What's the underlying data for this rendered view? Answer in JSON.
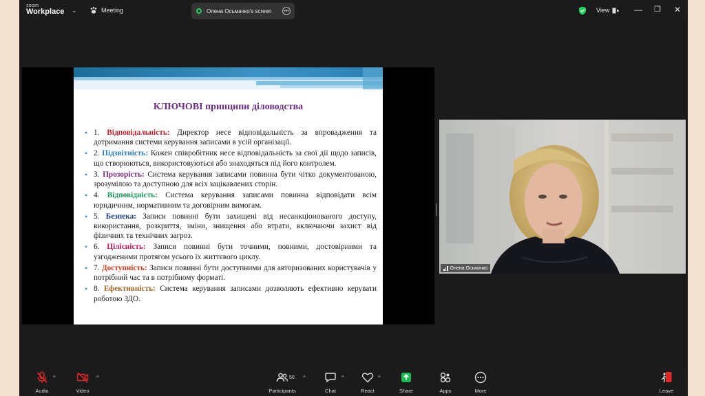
{
  "app": {
    "logo_small": "zoom",
    "logo_big": "Workplace",
    "meeting_label": "Meeting"
  },
  "screen_share": {
    "label": "Олена Осьмачко's screen",
    "indicator_letter": "O"
  },
  "titlebar": {
    "view_label": "View",
    "minimize": "—",
    "restore": "❐",
    "close": "✕"
  },
  "slide": {
    "title": "КЛЮЧОВІ принципи діловодства",
    "items": [
      {
        "num": "1.",
        "kw": "Відповідальність:",
        "color": "#c0202a",
        "text": " Директор несе відповідальність за впровадження та дотримання системи керування записами в усій організації."
      },
      {
        "num": "2.",
        "kw": "Підзвітність:",
        "color": "#2d7bc0",
        "text": " Кожен співробітник несе відповідальність за свої дії щодо записів, що створюються, використовуються або знаходяться під його контролем."
      },
      {
        "num": "3.",
        "kw": "Прозорість:",
        "color": "#7a2a7a",
        "text": " Система керування записами повинна бути чітко документованою, зрозумілою та доступною для всіх зацікавлених сторін."
      },
      {
        "num": "4.",
        "kw": "Відповідність:",
        "color": "#1e9a5a",
        "text": " Система керування записами повинна відповідати всім юридичним, нормативним та договірним вимогам."
      },
      {
        "num": "5.",
        "kw": "Безпека:",
        "color": "#1e3f8a",
        "text": " Записи повинні бути захищені від несанкціонованого доступу, використання, розкриття, зміни, знищення або втрати, включаючи захист від фізичних та технічних загроз."
      },
      {
        "num": "6.",
        "kw": "Цілісність:",
        "color": "#c2185b",
        "text": " Записи повинні бути точними, повними, достовірними та узгодженими протягом усього їх життєвого циклу."
      },
      {
        "num": "7.",
        "kw": "Доступність:",
        "color": "#d23a1e",
        "text": " Записи повинні бути доступними для авторизованих користувачів у потрібний час та в потрібному форматі."
      },
      {
        "num": "8.",
        "kw": "Ефективність:",
        "color": "#a0672a",
        "text": " Система керування записами дозволяють ефективно керувати роботою ЗДО."
      }
    ]
  },
  "participant": {
    "name": "Олена Осьмачко"
  },
  "toolbar": {
    "audio": "Audio",
    "video": "Video",
    "participants": "Participants",
    "participants_count": "50",
    "chat": "Chat",
    "react": "React",
    "share": "Share",
    "apps": "Apps",
    "more": "More",
    "leave": "Leave"
  },
  "colors": {
    "accent_green": "#23d160",
    "share_green": "#1db954",
    "leave_red": "#e02828",
    "muted_red": "#e02828"
  }
}
